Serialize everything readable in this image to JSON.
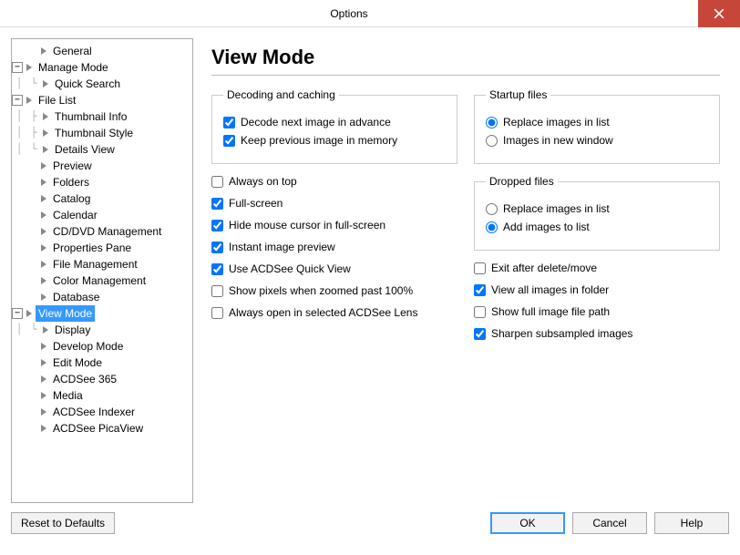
{
  "title": "Options",
  "tree": {
    "general": "General",
    "manage_mode": "Manage Mode",
    "quick_search": "Quick Search",
    "file_list": "File List",
    "thumb_info": "Thumbnail Info",
    "thumb_style": "Thumbnail Style",
    "details_view": "Details View",
    "preview": "Preview",
    "folders": "Folders",
    "catalog": "Catalog",
    "calendar": "Calendar",
    "cd_dvd": "CD/DVD Management",
    "prop_pane": "Properties Pane",
    "file_mgmt": "File Management",
    "color_mgmt": "Color Management",
    "database": "Database",
    "view_mode": "View Mode",
    "display": "Display",
    "develop_mode": "Develop Mode",
    "edit_mode": "Edit Mode",
    "acdsee365": "ACDSee 365",
    "media": "Media",
    "indexer": "ACDSee Indexer",
    "picaview": "ACDSee PicaView"
  },
  "page": {
    "heading": "View Mode",
    "group_decoding": "Decoding and caching",
    "decode_next": "Decode next image in advance",
    "keep_prev": "Keep previous image in memory",
    "always_on_top": "Always on top",
    "full_screen": "Full-screen",
    "hide_cursor": "Hide mouse cursor in full-screen",
    "instant_preview": "Instant image preview",
    "quick_view": "Use ACDSee Quick View",
    "show_pixels": "Show pixels when zoomed past 100%",
    "always_open_lens": "Always open in selected ACDSee Lens",
    "group_startup": "Startup files",
    "startup_replace": "Replace images in list",
    "startup_newwin": "Images in new window",
    "group_dropped": "Dropped files",
    "dropped_replace": "Replace images in list",
    "dropped_add": "Add images to list",
    "exit_after": "Exit after delete/move",
    "view_all": "View all images in folder",
    "show_path": "Show full image file path",
    "sharpen": "Sharpen subsampled images"
  },
  "buttons": {
    "reset": "Reset to Defaults",
    "ok": "OK",
    "cancel": "Cancel",
    "help": "Help"
  },
  "state": {
    "decode_next": true,
    "keep_prev": true,
    "always_on_top": false,
    "full_screen": true,
    "hide_cursor": true,
    "instant_preview": true,
    "quick_view": true,
    "show_pixels": false,
    "always_open_lens": false,
    "startup": "replace",
    "dropped": "add",
    "exit_after": false,
    "view_all": true,
    "show_path": false,
    "sharpen": true
  }
}
